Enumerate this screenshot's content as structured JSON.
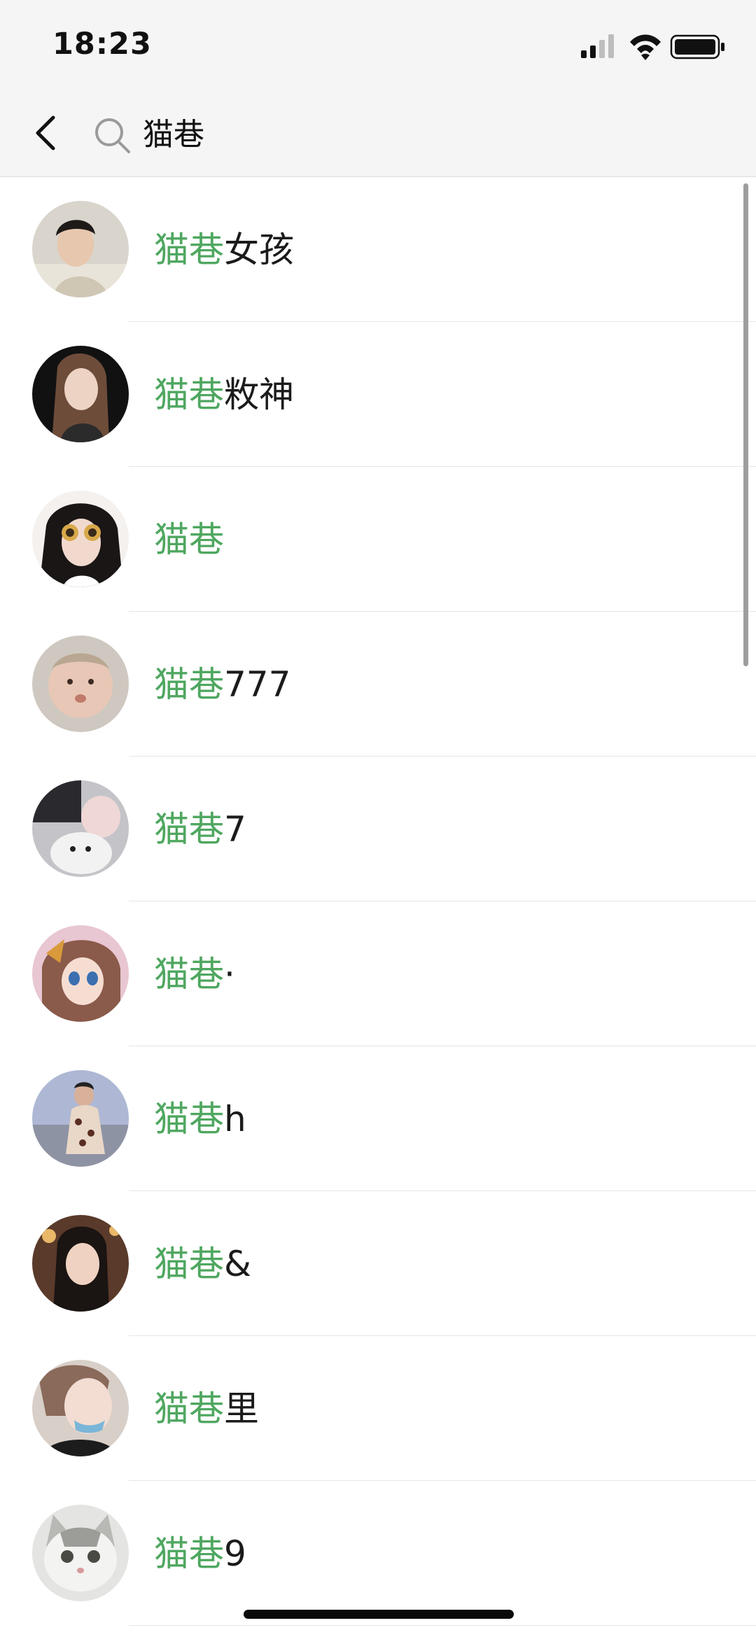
{
  "status_bar": {
    "time": "18:23"
  },
  "search": {
    "query": "猫巷"
  },
  "icons": {
    "back": "chevron-left-icon",
    "search": "search-icon",
    "signal": "cellular-signal-icon",
    "wifi": "wifi-icon",
    "battery": "battery-icon"
  },
  "colors": {
    "highlight": "#4fa760",
    "header_bg": "#f5f5f5"
  },
  "results": [
    {
      "match": "猫巷",
      "suffix": "女孩",
      "avatar": "avatar-photo"
    },
    {
      "match": "猫巷",
      "suffix": "敉神",
      "avatar": "avatar-photo"
    },
    {
      "match": "猫巷",
      "suffix": "",
      "avatar": "avatar-photo"
    },
    {
      "match": "猫巷",
      "suffix": "777",
      "avatar": "avatar-photo"
    },
    {
      "match": "猫巷",
      "suffix": "7",
      "avatar": "avatar-photo"
    },
    {
      "match": "猫巷",
      "suffix": "·",
      "avatar": "avatar-illustration"
    },
    {
      "match": "猫巷",
      "suffix": "h",
      "avatar": "avatar-photo"
    },
    {
      "match": "猫巷",
      "suffix": "&",
      "avatar": "avatar-photo"
    },
    {
      "match": "猫巷",
      "suffix": "里",
      "avatar": "avatar-photo"
    },
    {
      "match": "猫巷",
      "suffix": "9",
      "avatar": "avatar-cat-photo"
    }
  ]
}
